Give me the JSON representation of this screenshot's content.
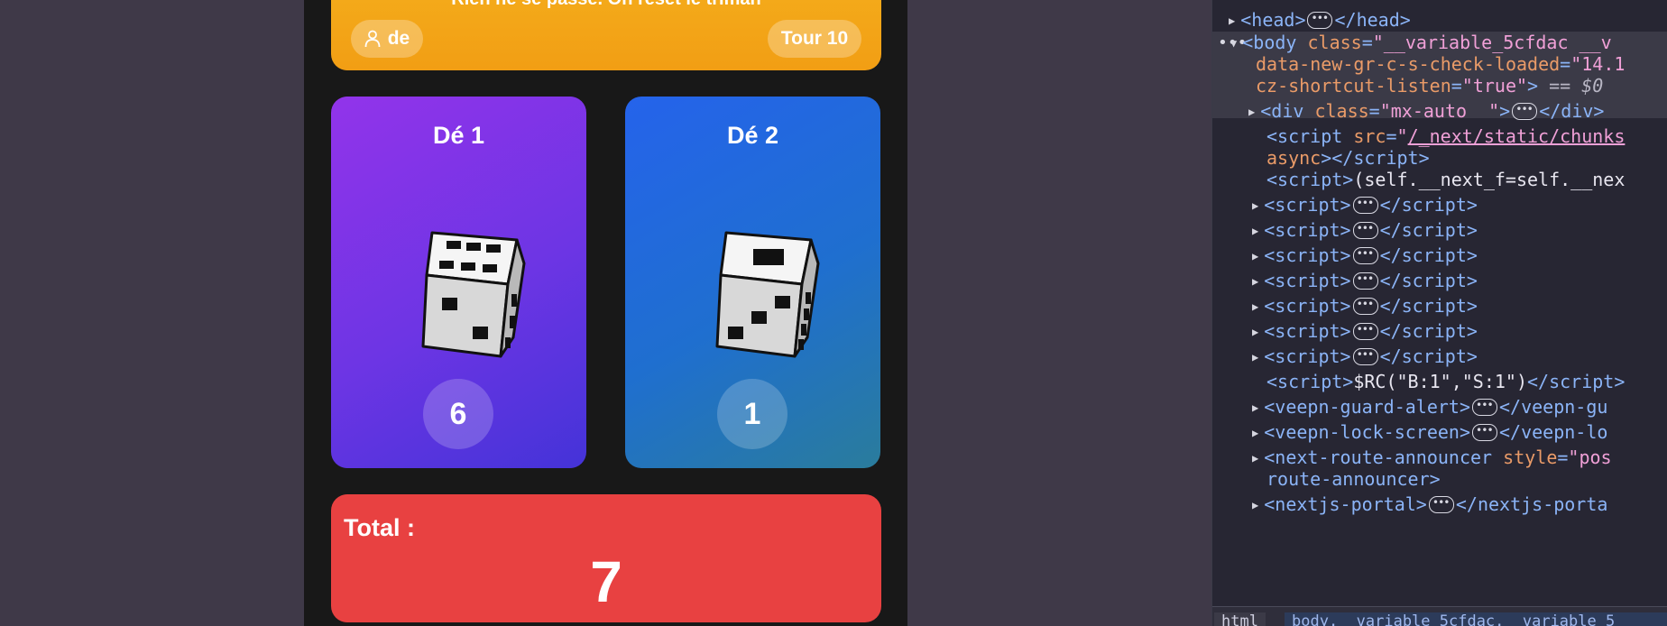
{
  "app": {
    "banner_message": "Rien ne se passe. On reset le triman",
    "player_label": "de",
    "turn_label": "Tour 10",
    "dice": [
      {
        "title": "Dé 1",
        "value": "6"
      },
      {
        "title": "Dé 2",
        "value": "1"
      }
    ],
    "total_label": "Total :",
    "total_value": "7"
  },
  "devtools": {
    "lines": [
      {
        "tri": "r",
        "html": "<span class='tag'>&lt;head&gt;</span><span class='ell'></span><span class='tag'>&lt;/head&gt;</span>"
      },
      {
        "tri": "d",
        "html": "<span class='tag'>&lt;body</span> <span class='attr'>class</span><span class='tag'>=</span><span class='val'>\"__variable_5cfdac __v</span>"
      },
      {
        "tri": "",
        "html": "<span class='attr'>data-new-gr-c-s-check-loaded</span><span class='tag'>=</span><span class='val'>\"14.1</span>"
      },
      {
        "tri": "",
        "html": "<span class='attr'>cz-shortcut-listen</span><span class='tag'>=</span><span class='val'>\"true\"</span><span class='tag'>&gt;</span> <span class='dim'>== $0</span>"
      },
      {
        "tri": "r",
        "html": "<span class='tag'>&lt;div</span> <span class='attr'>class</span><span class='tag'>=</span><span class='val'>\"mx-auto  \"</span><span class='tag'>&gt;</span><span class='ell'></span><span class='tag'>&lt;/div&gt;</span>"
      },
      {
        "tri": "",
        "html": "<span class='tag'>&lt;script</span> <span class='attr'>src</span><span class='tag'>=</span><span class='val'>\"</span><span class='link'>/_next/static/chunks</span>"
      },
      {
        "tri": "",
        "html": "<span class='attr'>async</span><span class='tag'>&gt;&lt;/script&gt;</span>"
      },
      {
        "tri": "",
        "html": "<span class='tag'>&lt;script&gt;</span><span class='plain'>(self.__next_f=self.__nex</span>"
      },
      {
        "tri": "r",
        "html": "<span class='tag'>&lt;script&gt;</span><span class='ell'></span><span class='tag'>&lt;/script&gt;</span>"
      },
      {
        "tri": "r",
        "html": "<span class='tag'>&lt;script&gt;</span><span class='ell'></span><span class='tag'>&lt;/script&gt;</span>"
      },
      {
        "tri": "r",
        "html": "<span class='tag'>&lt;script&gt;</span><span class='ell'></span><span class='tag'>&lt;/script&gt;</span>"
      },
      {
        "tri": "r",
        "html": "<span class='tag'>&lt;script&gt;</span><span class='ell'></span><span class='tag'>&lt;/script&gt;</span>"
      },
      {
        "tri": "r",
        "html": "<span class='tag'>&lt;script&gt;</span><span class='ell'></span><span class='tag'>&lt;/script&gt;</span>"
      },
      {
        "tri": "r",
        "html": "<span class='tag'>&lt;script&gt;</span><span class='ell'></span><span class='tag'>&lt;/script&gt;</span>"
      },
      {
        "tri": "r",
        "html": "<span class='tag'>&lt;script&gt;</span><span class='ell'></span><span class='tag'>&lt;/script&gt;</span>"
      },
      {
        "tri": "",
        "html": "<span class='tag'>&lt;script&gt;</span><span class='plain'>$RC(\"B:1\",\"S:1\")</span><span class='tag'>&lt;/script&gt;</span>"
      },
      {
        "tri": "r",
        "html": "<span class='tag'>&lt;veepn-guard-alert&gt;</span><span class='ell'></span><span class='tag'>&lt;/veepn-gu</span>"
      },
      {
        "tri": "r",
        "html": "<span class='tag'>&lt;veepn-lock-screen&gt;</span><span class='ell'></span><span class='tag'>&lt;/veepn-lo</span>"
      },
      {
        "tri": "r",
        "html": "<span class='tag'>&lt;next-route-announcer</span> <span class='attr'>style</span><span class='tag'>=</span><span class='val'>\"pos</span>"
      },
      {
        "tri": "",
        "html": "<span class='tag'>route-announcer&gt;</span>"
      },
      {
        "tri": "r",
        "html": "<span class='tag'>&lt;nextjs-portal&gt;</span><span class='ell'></span><span class='tag'>&lt;/nextjs-porta</span>"
      }
    ],
    "crumb_html": "html",
    "crumb_body": "body.__variable_5cfdac.__variable_5"
  }
}
